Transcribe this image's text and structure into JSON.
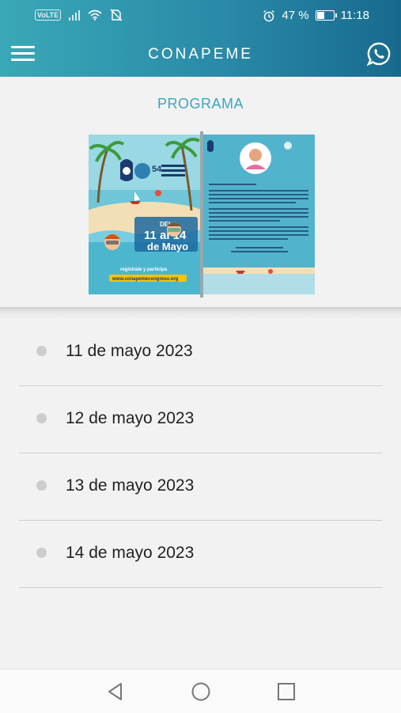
{
  "status_bar": {
    "volte": "VoLTE",
    "battery_percent": "47 %",
    "time": "11:18"
  },
  "app_bar": {
    "title": "CONAPEME"
  },
  "section": {
    "title": "PROGRAMA"
  },
  "magazine": {
    "badge_number": "54",
    "dates_line1": "DEL",
    "dates_line2": "11 al 14",
    "dates_line3": "de Mayo",
    "register_text": "regístrate y participa",
    "website": "www.conapemecongreso.org"
  },
  "days": [
    {
      "label": "11 de mayo 2023"
    },
    {
      "label": "12 de mayo 2023"
    },
    {
      "label": "13 de mayo 2023"
    },
    {
      "label": "14 de mayo 2023"
    }
  ],
  "colors": {
    "accent": "#3ba6bf",
    "header_start": "#3aa8b7",
    "header_end": "#186a8d"
  }
}
